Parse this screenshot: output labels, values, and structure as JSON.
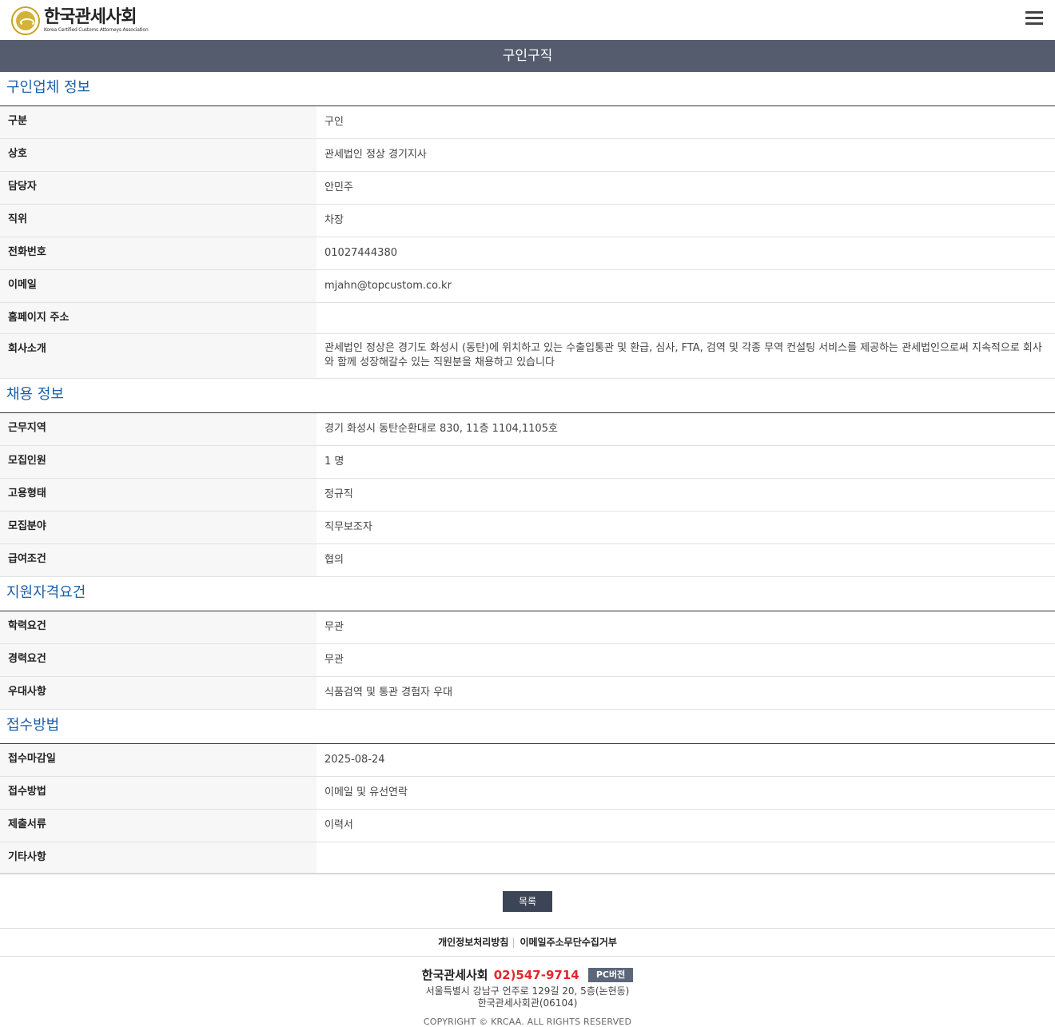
{
  "header": {
    "logo_title": "한국관세사회",
    "logo_subtitle": "Korea Certified Customs Attorneys Association"
  },
  "page_title": "구인구직",
  "sections": {
    "company": {
      "title": "구인업체 정보",
      "rows": [
        {
          "label": "구분",
          "value": "구인"
        },
        {
          "label": "상호",
          "value": "관세법인 정상 경기지사"
        },
        {
          "label": "담당자",
          "value": "안민주"
        },
        {
          "label": "직위",
          "value": "차장"
        },
        {
          "label": "전화번호",
          "value": "01027444380"
        },
        {
          "label": "이메일",
          "value": "mjahn@topcustom.co.kr"
        },
        {
          "label": "홈페이지 주소",
          "value": ""
        },
        {
          "label": "회사소개",
          "value": "관세법인 정상은 경기도 화성시 (동탄)에 위치하고 있는 수출입통관 및 환급, 심사, FTA, 검역 및 각종 무역 컨설팅 서비스를 제공하는 관세법인으로써 지속적으로 회사와 함께 성장해갈수 있는 직원분을 채용하고 있습니다"
        }
      ]
    },
    "recruit": {
      "title": "채용 정보",
      "rows": [
        {
          "label": "근무지역",
          "value": "경기 화성시 동탄순환대로 830, 11층 1104,1105호"
        },
        {
          "label": "모집인원",
          "value": "1 명"
        },
        {
          "label": "고용형태",
          "value": "정규직"
        },
        {
          "label": "모집분야",
          "value": "직무보조자"
        },
        {
          "label": "급여조건",
          "value": "협의"
        }
      ]
    },
    "qualification": {
      "title": "지원자격요건",
      "rows": [
        {
          "label": "학력요건",
          "value": "무관"
        },
        {
          "label": "경력요건",
          "value": "무관"
        },
        {
          "label": "우대사항",
          "value": "식품검역 및 통관 경험자 우대"
        }
      ]
    },
    "apply": {
      "title": "접수방법",
      "rows": [
        {
          "label": "접수마감일",
          "value": "2025-08-24"
        },
        {
          "label": "접수방법",
          "value": "이메일 및 유선연락"
        },
        {
          "label": "제출서류",
          "value": "이력서"
        },
        {
          "label": "기타사항",
          "value": ""
        }
      ]
    }
  },
  "list_button": "목록",
  "footer": {
    "link_privacy": "개인정보처리방침",
    "link_separator": "|",
    "link_email": "이메일주소무단수집거부",
    "org_name": "한국관세사회",
    "phone": "02)547-9714",
    "pc_button": "PC버전",
    "address1": "서울특별시 강남구 언주로 129길 20, 5층(논현동)",
    "address2": "한국관세사회관(06104)",
    "copyright": "COPYRIGHT © KRCAA. ALL RIGHTS RESERVED"
  },
  "colors": {
    "title_bar": "#545c6e",
    "section_title": "#1a5fa8",
    "phone": "#e3262d",
    "button": "#3c4556"
  }
}
